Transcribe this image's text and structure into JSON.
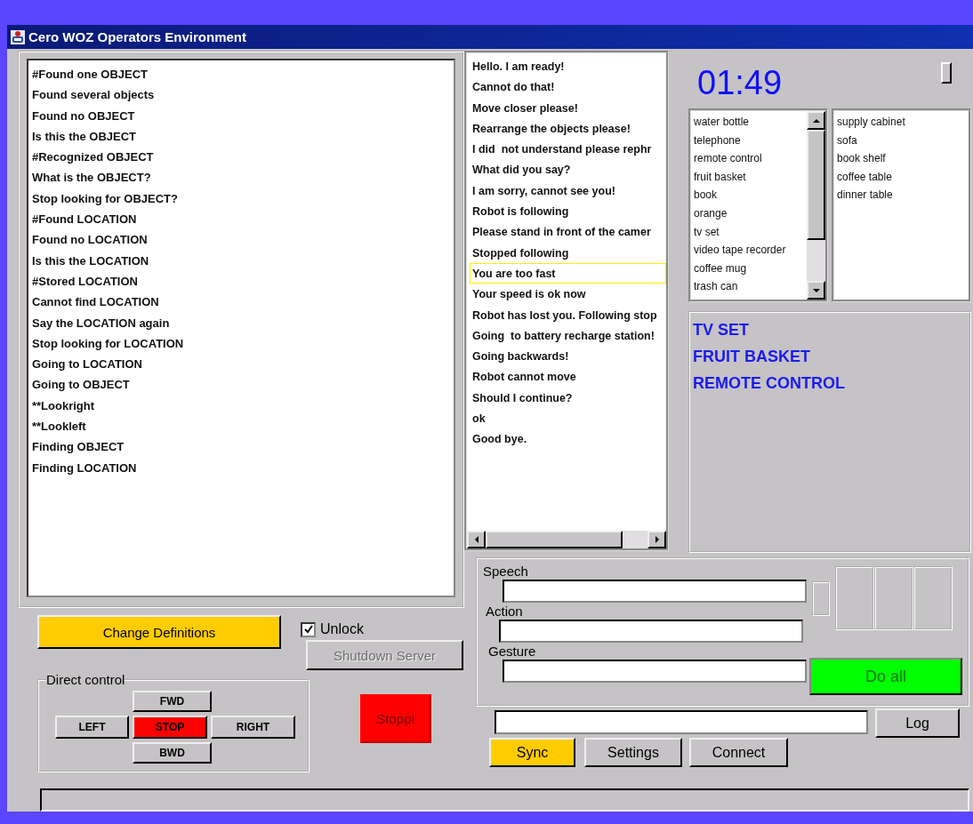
{
  "window": {
    "title": "Cero WOZ Operators Environment"
  },
  "commands": [
    {
      "text": "#Found one OBJECT"
    },
    {
      "text": "Found several objects"
    },
    {
      "text": "Found no OBJECT"
    },
    {
      "text": "Is this the OBJECT"
    },
    {
      "text": "#Recognized OBJECT"
    },
    {
      "text": "What is the OBJECT?"
    },
    {
      "text": "Stop looking for OBJECT?"
    },
    {
      "text": "#Found LOCATION"
    },
    {
      "text": "Found no LOCATION"
    },
    {
      "text": "Is this the LOCATION"
    },
    {
      "text": "#Stored LOCATION"
    },
    {
      "text": "Cannot find LOCATION"
    },
    {
      "text": "Say the LOCATION again"
    },
    {
      "text": "Stop looking for LOCATION"
    },
    {
      "text": "Going to LOCATION"
    },
    {
      "text": "Going to OBJECT"
    },
    {
      "text": "**Lookright"
    },
    {
      "text": "**Lookleft"
    },
    {
      "text": "Finding OBJECT"
    },
    {
      "text": "Finding LOCATION"
    }
  ],
  "utterances": [
    {
      "text": "Hello. I am ready!",
      "selected": false
    },
    {
      "text": "Cannot do that!",
      "selected": false
    },
    {
      "text": "Move closer please!",
      "selected": false
    },
    {
      "text": "Rearrange the objects please!",
      "selected": false
    },
    {
      "text": "I did  not understand please rephr",
      "selected": false
    },
    {
      "text": "What did you say?",
      "selected": false
    },
    {
      "text": "I am sorry, cannot see you!",
      "selected": false
    },
    {
      "text": "Robot is following",
      "selected": false
    },
    {
      "text": "Please stand in front of the camer",
      "selected": false
    },
    {
      "text": "Stopped following",
      "selected": false
    },
    {
      "text": "You are too fast",
      "selected": true
    },
    {
      "text": "Your speed is ok now",
      "selected": false
    },
    {
      "text": "Robot has lost you. Following stop",
      "selected": false
    },
    {
      "text": "Going  to battery recharge station!",
      "selected": false
    },
    {
      "text": "Going backwards!",
      "selected": false
    },
    {
      "text": "Robot cannot move",
      "selected": false
    },
    {
      "text": "Should I continue?",
      "selected": false
    },
    {
      "text": "ok",
      "selected": false
    },
    {
      "text": "Good bye.",
      "selected": false
    }
  ],
  "timer": "01:49",
  "objects": [
    "water bottle",
    "telephone",
    "remote control",
    "fruit basket",
    "book",
    "orange",
    "tv set",
    "video tape recorder",
    "coffee mug",
    "trash can"
  ],
  "locations": [
    "supply cabinet",
    "sofa",
    "book shelf",
    "coffee table",
    "dinner table"
  ],
  "selection": [
    "TV SET",
    "FRUIT BASKET",
    "REMOTE CONTROL"
  ],
  "change_definitions": {
    "label": "Change Definitions"
  },
  "unlock": {
    "label": "Unlock",
    "checked": true
  },
  "shutdown": {
    "label": "Shutdown Server",
    "disabled": true
  },
  "direct_control": {
    "title": "Direct control",
    "buttons": [
      {
        "label": "FWD",
        "color": "#c6c3c6"
      },
      {
        "label": "LEFT",
        "color": "#c6c3c6"
      },
      {
        "label": "STOP",
        "color": "#ff0000"
      },
      {
        "label": "RIGHT",
        "color": "#c6c3c6"
      },
      {
        "label": "BWD",
        "color": "#c6c3c6"
      }
    ]
  },
  "stop_button": {
    "label": "Stopp!"
  },
  "action_panel": {
    "fields": [
      {
        "label": "Speech"
      },
      {
        "label": "Action"
      },
      {
        "label": "Gesture"
      }
    ],
    "do_all": "Do all"
  },
  "log": {
    "button": "Log"
  },
  "buttons": [
    {
      "label": "Sync",
      "color": "#ffcc00"
    },
    {
      "label": "Settings",
      "color": "#c6c3c6"
    },
    {
      "label": "Connect",
      "color": "#c6c3c6"
    }
  ]
}
